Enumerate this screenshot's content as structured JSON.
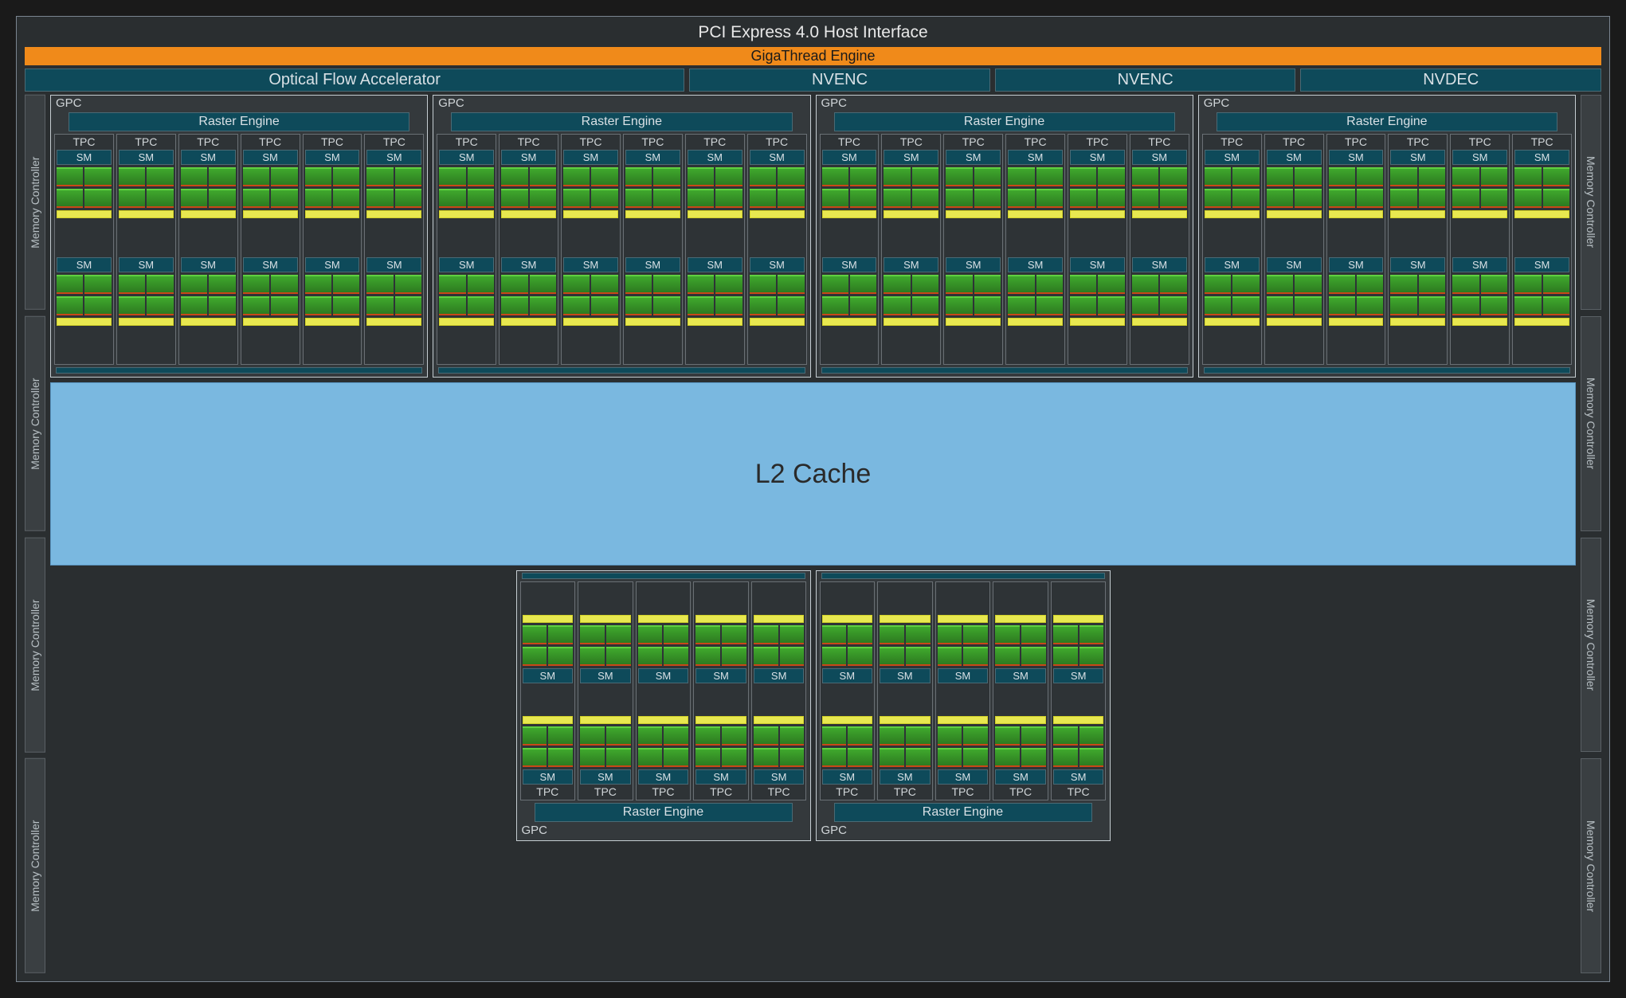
{
  "diagram": {
    "top_interface": "PCI Express 4.0 Host Interface",
    "thread_engine": "GigaThread Engine",
    "accelerators": {
      "ofa": "Optical Flow Accelerator",
      "nvenc1": "NVENC",
      "nvenc2": "NVENC",
      "nvdec": "NVDEC"
    },
    "memory_controller": "Memory Controller",
    "l2_cache": "L2 Cache",
    "gpc": {
      "label": "GPC",
      "raster_engine": "Raster Engine",
      "tpc_label": "TPC",
      "sm_label": "SM",
      "top_gpc_count": 4,
      "bottom_gpc_count": 2,
      "tpcs_per_top_gpc": 6,
      "tpcs_per_bottom_gpc": 5,
      "sms_per_tpc": 2
    },
    "memory_controllers_per_side": 4
  }
}
